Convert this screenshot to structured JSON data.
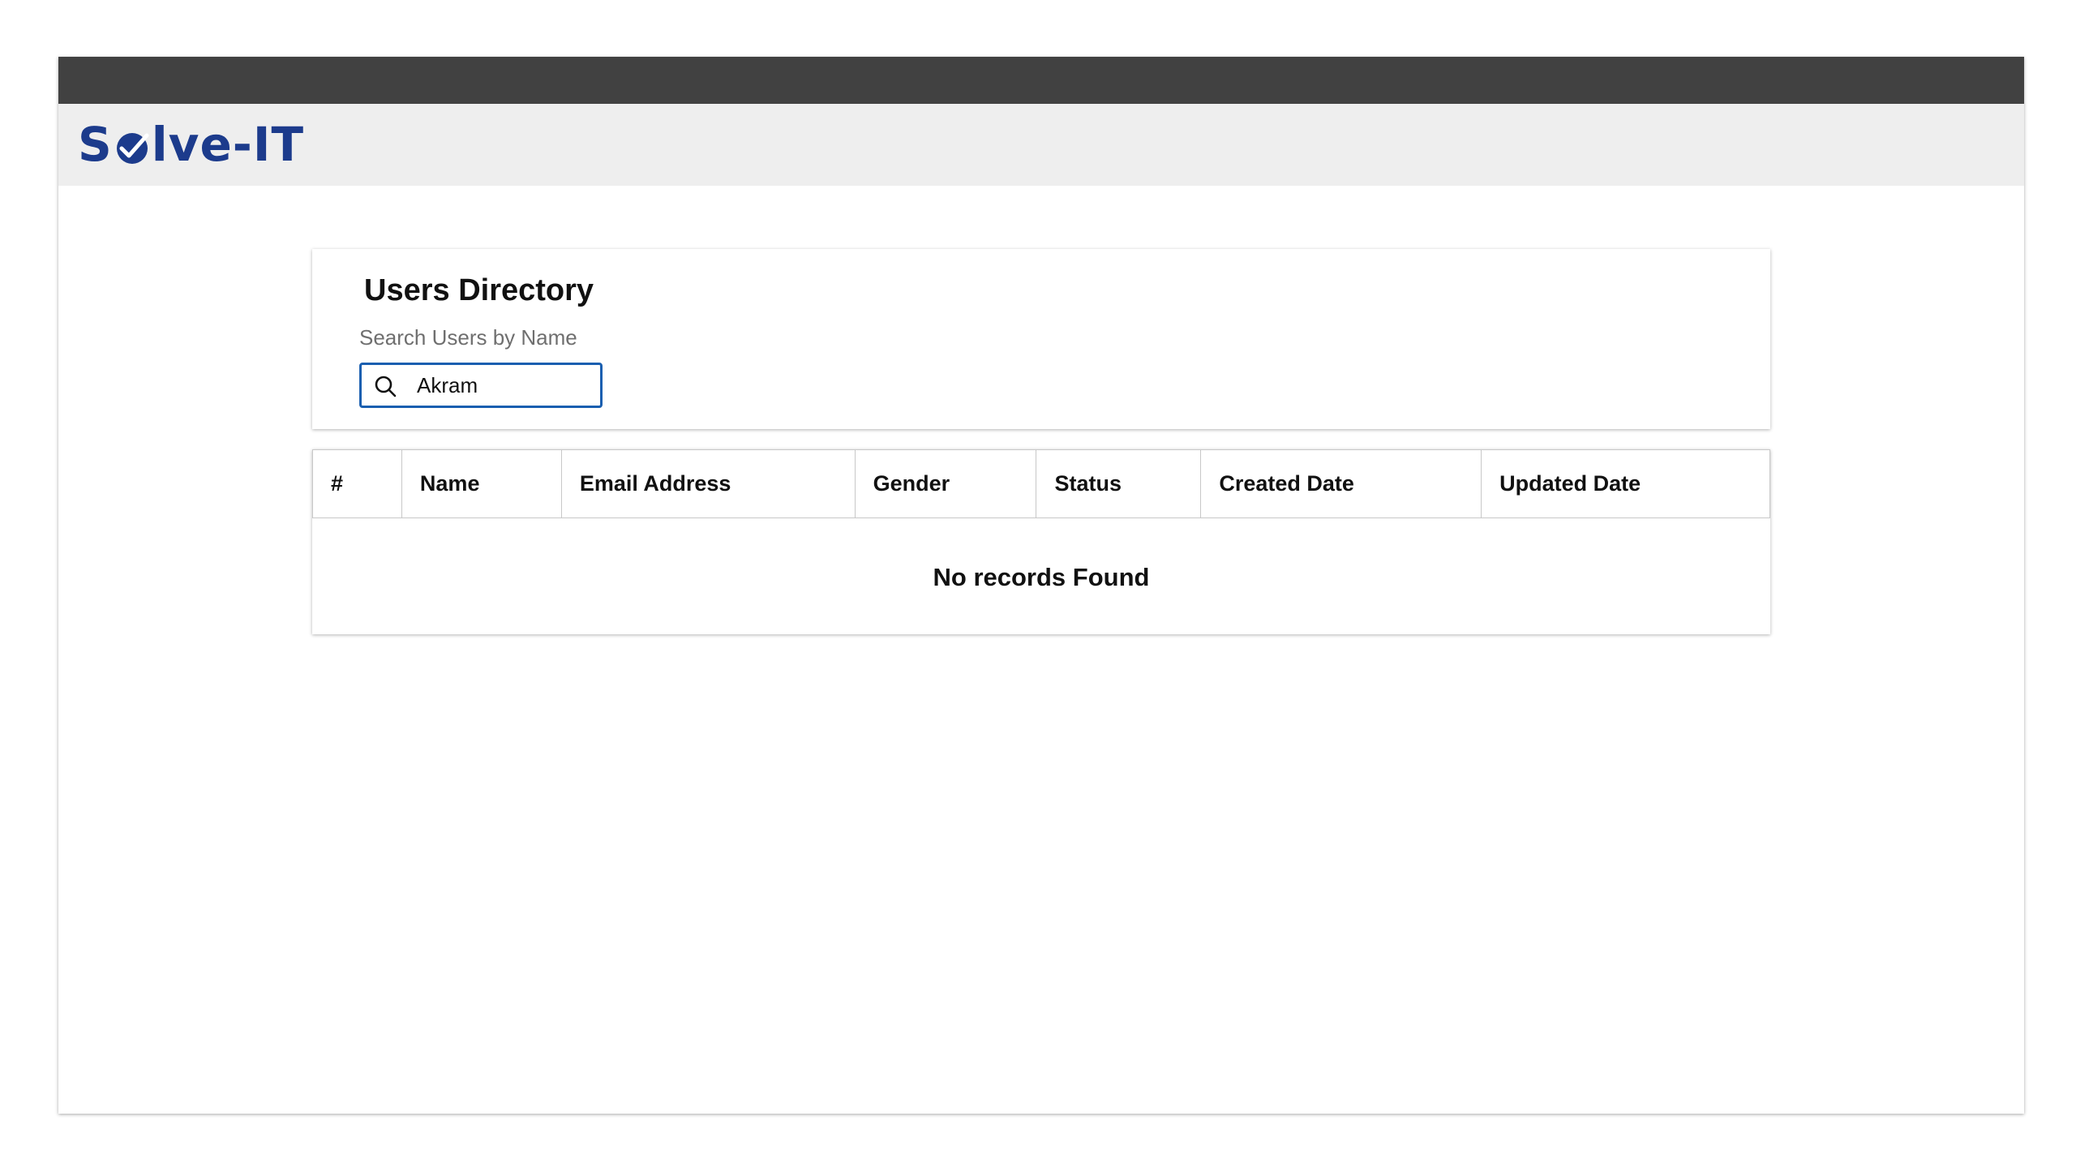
{
  "header": {
    "logo_text_start": "S",
    "logo_text_end": "lve-IT",
    "brand_color": "#1c3b8c"
  },
  "search_card": {
    "title": "Users Directory",
    "search_label": "Search Users by Name",
    "search_value": "Akram",
    "search_icon": "search-icon"
  },
  "table": {
    "columns": [
      "#",
      "Name",
      "Email Address",
      "Gender",
      "Status",
      "Created Date",
      "Updated Date"
    ],
    "empty_message": "No records Found"
  },
  "colors": {
    "top_bar": "#414141",
    "header_bg": "#eeeeee",
    "input_border": "#1a5fb0"
  }
}
